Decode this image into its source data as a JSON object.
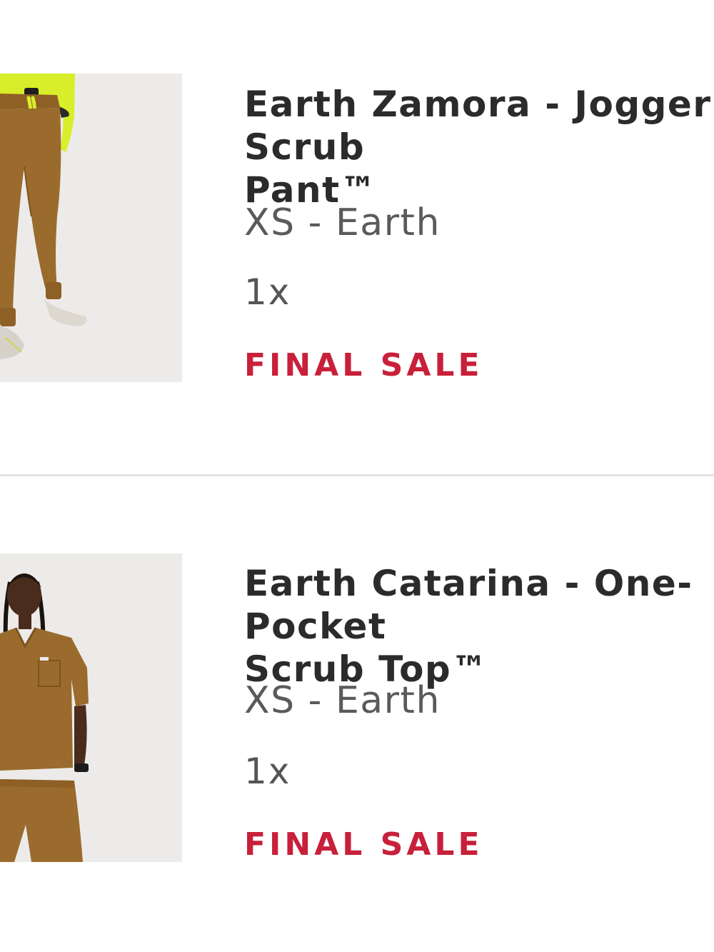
{
  "items": [
    {
      "title_line1": "Earth Zamora - Jogger Scrub",
      "title_line2": "Pant™",
      "variant": "XS - Earth",
      "quantity": "1x",
      "sale_badge": "FINAL SALE",
      "image_icon": "jogger-pant-photo-icon"
    },
    {
      "title_line1": "Earth Catarina - One-Pocket",
      "title_line2": "Scrub Top™",
      "variant": "XS - Earth",
      "quantity": "1x",
      "sale_badge": "FINAL SALE",
      "image_icon": "scrub-top-photo-icon"
    }
  ],
  "colors": {
    "final_sale": "#c8203a",
    "product": "#9a6b2c",
    "accent_neon": "#d8ee2a"
  }
}
